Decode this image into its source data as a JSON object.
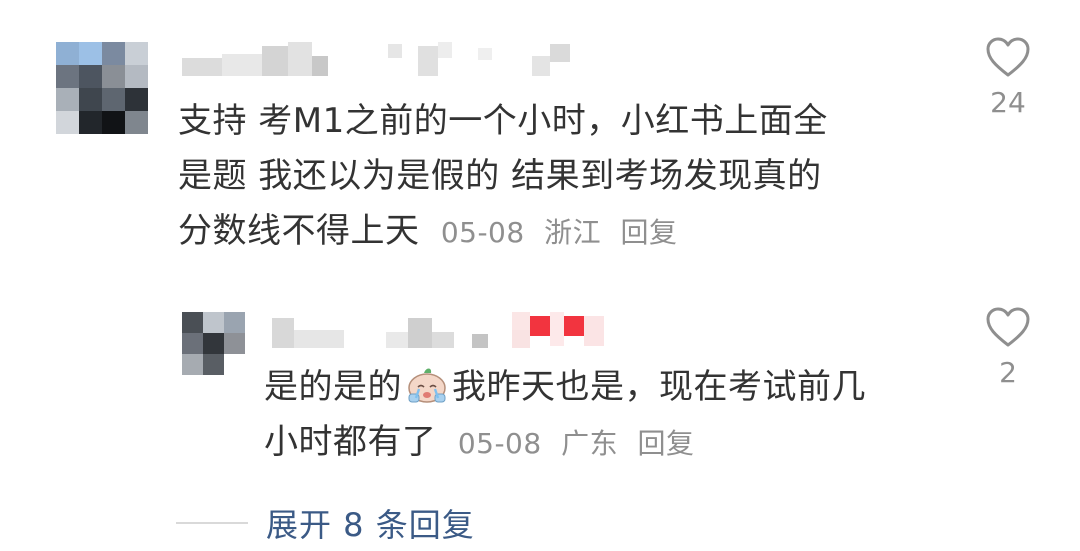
{
  "comment": {
    "text_lines": [
      "支持 考M1之前的一个小时，小红书上面全",
      "是题 我还以为是假的 结果到考场发现真的",
      "分数线不得上天"
    ],
    "date": "05-08",
    "location": "浙江",
    "reply_label": "回复",
    "like_count": "24",
    "like_icon": "heart-outline-icon"
  },
  "reply": {
    "text_before_emoji": "是的是的",
    "emoji": "crying-face-emoji",
    "text_after_emoji": "我昨天也是，现在考试前几",
    "text_line2": "小时都有了",
    "date": "05-08",
    "location": "广东",
    "reply_label": "回复",
    "like_count": "2",
    "like_icon": "heart-outline-icon"
  },
  "expand": {
    "label": "展开 8 条回复"
  },
  "colors": {
    "text": "#333333",
    "meta": "#8f8f8f",
    "link": "#3b5a86",
    "badge_red": "#f2343f"
  }
}
